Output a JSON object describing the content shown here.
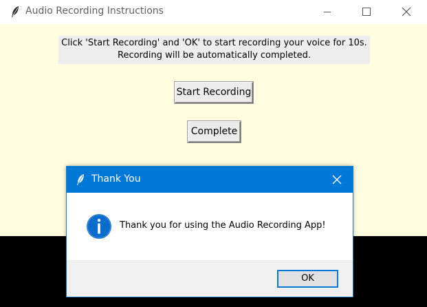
{
  "main_window": {
    "title": "Audio Recording Instructions",
    "icon": "feather-icon",
    "instructions_line1": "Click 'Start Recording' and 'OK' to start recording your voice for 10s.",
    "instructions_line2": "Recording will be automatically completed.",
    "start_button_label": "Start Recording",
    "complete_button_label": "Complete",
    "background_color": "#fffde0"
  },
  "dialog": {
    "title": "Thank You",
    "icon": "info-icon",
    "message": "Thank you for using the Audio Recording App!",
    "ok_button_label": "OK",
    "titlebar_color": "#0078d7"
  }
}
